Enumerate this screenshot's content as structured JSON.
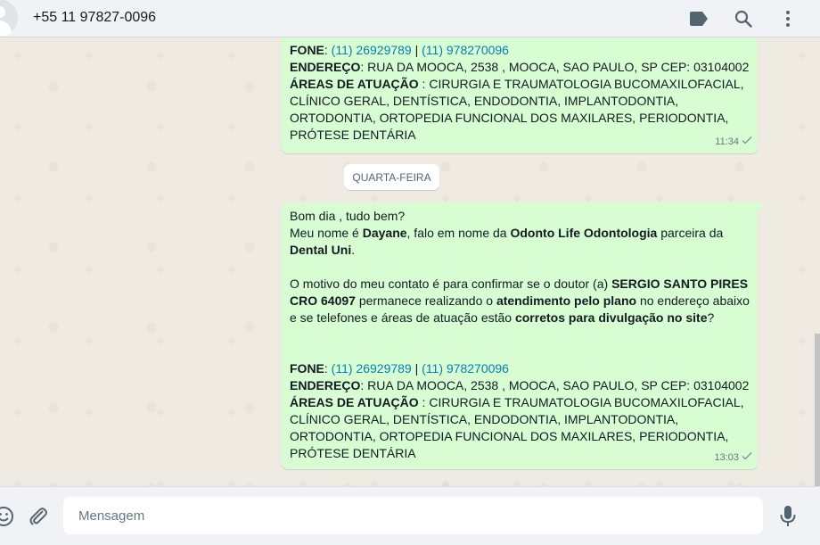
{
  "header": {
    "contact_name": "+55 11 97827-0096",
    "icons": [
      "label-icon",
      "search-icon",
      "menu-icon"
    ]
  },
  "messages": [
    {
      "fone_label": "FONE",
      "phone1": "(11) 26929789",
      "sep": "|",
      "phone2": "(11) 978270096",
      "endereco_label": "ENDEREÇO",
      "endereco": ": RUA DA MOOCA, 2538 , MOOCA, SAO PAULO, SP CEP: 03104002",
      "areas_label": "ÁREAS DE ATUAÇÃO",
      "areas": " : CIRURGIA E TRAUMATOLOGIA BUCOMAXILOFACIAL, CLÍNICO GERAL, DENTÍSTICA, ENDODONTIA, IMPLANTODONTIA, ORTODONTIA, ORTOPEDIA FUNCIONAL DOS MAXILARES, PERIODONTIA, PRÓTESE DENTÁRIA",
      "time": "11:34"
    },
    {
      "greeting": "Bom dia , tudo bem?",
      "intro_1": "Meu nome é ",
      "name": "Dayane",
      "intro_2": ", falo em nome da ",
      "company": "Odonto Life Odontologia",
      "intro_3": " parceira da ",
      "partner": "Dental Uni",
      "intro_4": ".",
      "motive_1": "O motivo do meu contato é para confirmar se o doutor (a) ",
      "doctor": "SERGIO SANTO PIRES CRO 64097",
      "motive_2": " permanece realizando o ",
      "plan": "atendimento pelo plano",
      "motive_3": " no endereço abaixo e se telefones e áreas de atuação estão ",
      "correct": "corretos para divulgação no site",
      "motive_4": "?",
      "fone_label": "FONE",
      "phone1": "(11) 26929789",
      "sep": "|",
      "phone2": "(11) 978270096",
      "endereco_label": "ENDEREÇO",
      "endereco": ": RUA DA MOOCA, 2538 , MOOCA, SAO PAULO, SP CEP: 03104002",
      "areas_label": "ÁREAS DE ATUAÇÃO",
      "areas": " : CIRURGIA E TRAUMATOLOGIA BUCOMAXILOFACIAL, CLÍNICO GERAL, DENTÍSTICA, ENDODONTIA, IMPLANTODONTIA, ORTODONTIA, ORTOPEDIA FUNCIONAL DOS MAXILARES, PERIODONTIA, PRÓTESE DENTÁRIA",
      "time": "13:03"
    }
  ],
  "day_divider": "QUARTA-FEIRA",
  "composer": {
    "placeholder": "Mensagem",
    "icons": [
      "emoji-icon",
      "attach-icon",
      "microphone-icon"
    ]
  },
  "colors": {
    "bubble_out": "#d9fdd3",
    "link": "#027eb5",
    "chat_bg": "#efeae2",
    "bar_bg": "#f0f2f5"
  }
}
